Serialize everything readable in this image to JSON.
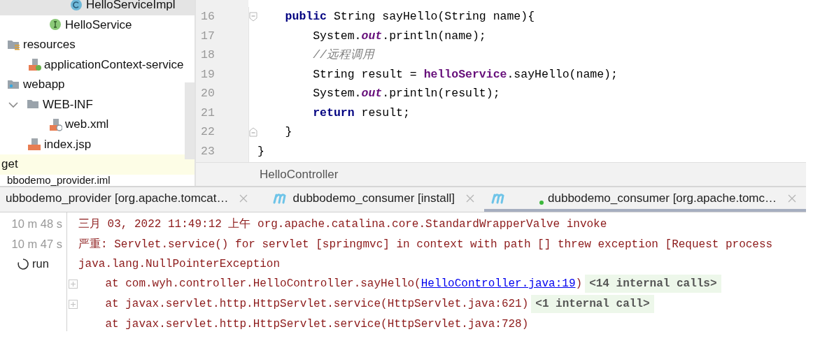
{
  "project_tree": {
    "items": [
      {
        "label": "HelloServiceImpl",
        "kind": "class",
        "selected": true
      },
      {
        "label": "HelloService",
        "kind": "interface",
        "selected": false
      },
      {
        "label": "resources",
        "kind": "resources",
        "selected": false,
        "children": [
          {
            "label": "applicationContext-service",
            "kind": "spring-xml",
            "selected": false
          }
        ]
      },
      {
        "label": "webapp",
        "kind": "web-folder",
        "selected": false,
        "children": [
          {
            "label": "WEB-INF",
            "kind": "folder",
            "selected": false,
            "expanded": true,
            "children": [
              {
                "label": "web.xml",
                "kind": "web-xml",
                "selected": false
              }
            ]
          },
          {
            "label": "index.jsp",
            "kind": "jsp",
            "selected": false
          }
        ]
      },
      {
        "label": "get",
        "kind": "excluded",
        "selected": false
      },
      {
        "label": "bbodemo_provider.iml",
        "kind": "plain",
        "selected": false
      }
    ]
  },
  "editor": {
    "lines": [
      {
        "number": "16",
        "fold_start": true,
        "fold_end": false,
        "segments": [
          {
            "kind": "keyword",
            "text": "    public"
          },
          {
            "kind": "text",
            "text": " String sayHello(String name){"
          }
        ]
      },
      {
        "number": "17",
        "fold_start": false,
        "fold_end": false,
        "segments": [
          {
            "kind": "text",
            "text": "        System."
          },
          {
            "kind": "static",
            "text": "out"
          },
          {
            "kind": "text",
            "text": ".println(name);"
          }
        ]
      },
      {
        "number": "18",
        "fold_start": false,
        "fold_end": false,
        "segments": [
          {
            "kind": "comment",
            "text": "        //远程调用"
          }
        ]
      },
      {
        "number": "19",
        "fold_start": false,
        "fold_end": false,
        "segments": [
          {
            "kind": "text",
            "text": "        String result = "
          },
          {
            "kind": "field",
            "text": "helloService"
          },
          {
            "kind": "text",
            "text": ".sayHello(name);"
          }
        ]
      },
      {
        "number": "20",
        "fold_start": false,
        "fold_end": false,
        "segments": [
          {
            "kind": "text",
            "text": "        System."
          },
          {
            "kind": "static",
            "text": "out"
          },
          {
            "kind": "text",
            "text": ".println(result);"
          }
        ]
      },
      {
        "number": "21",
        "fold_start": false,
        "fold_end": false,
        "segments": [
          {
            "kind": "keyword",
            "text": "        return"
          },
          {
            "kind": "text",
            "text": " result;"
          }
        ]
      },
      {
        "number": "22",
        "fold_start": false,
        "fold_end": true,
        "segments": [
          {
            "kind": "text",
            "text": "    }"
          }
        ]
      },
      {
        "number": "23",
        "fold_start": false,
        "fold_end": false,
        "segments": [
          {
            "kind": "text",
            "text": "}"
          }
        ]
      }
    ],
    "breadcrumb": "HelloController"
  },
  "run_tabs": [
    {
      "label": "ubbodemo_provider [org.apache.tomcat…",
      "running": false,
      "selected": false
    },
    {
      "label": "dubbodemo_consumer [install]",
      "running": false,
      "selected": false
    },
    {
      "label": "dubbodemo_consumer [org.apache.tomc…",
      "running": true,
      "selected": true
    }
  ],
  "console": {
    "gutter": [
      {
        "kind": "time",
        "text": "10 m 48 s"
      },
      {
        "kind": "time",
        "text": "10 m 47 s"
      },
      {
        "kind": "running",
        "text": "run"
      }
    ],
    "lines": [
      {
        "fold": false,
        "segments": [
          {
            "kind": "text",
            "text": "三月 03, 2022 11:49:12 上午 org.apache.catalina.core.StandardWrapperValve invoke"
          }
        ]
      },
      {
        "fold": false,
        "segments": [
          {
            "kind": "text",
            "text": "严重: Servlet.service() for servlet [springmvc] in context with path [] threw exception [Request process"
          }
        ]
      },
      {
        "fold": false,
        "segments": [
          {
            "kind": "text",
            "text": "java.lang.NullPointerException"
          }
        ]
      },
      {
        "fold": true,
        "segments": [
          {
            "kind": "text",
            "text": "    at com.wyh.controller.HelloController.sayHello("
          },
          {
            "kind": "link",
            "text": "HelloController.java:19"
          },
          {
            "kind": "text",
            "text": ")"
          },
          {
            "kind": "note",
            "text": "<14 internal calls>"
          }
        ]
      },
      {
        "fold": true,
        "segments": [
          {
            "kind": "text",
            "text": "    at javax.servlet.http.HttpServlet.service(HttpServlet.java:621)"
          },
          {
            "kind": "note",
            "text": "<1 internal call>"
          }
        ]
      },
      {
        "fold": false,
        "segments": [
          {
            "kind": "text",
            "text": "    at javax.servlet.http.HttpServlet.service(HttpServlet.java:728)"
          }
        ]
      }
    ]
  }
}
